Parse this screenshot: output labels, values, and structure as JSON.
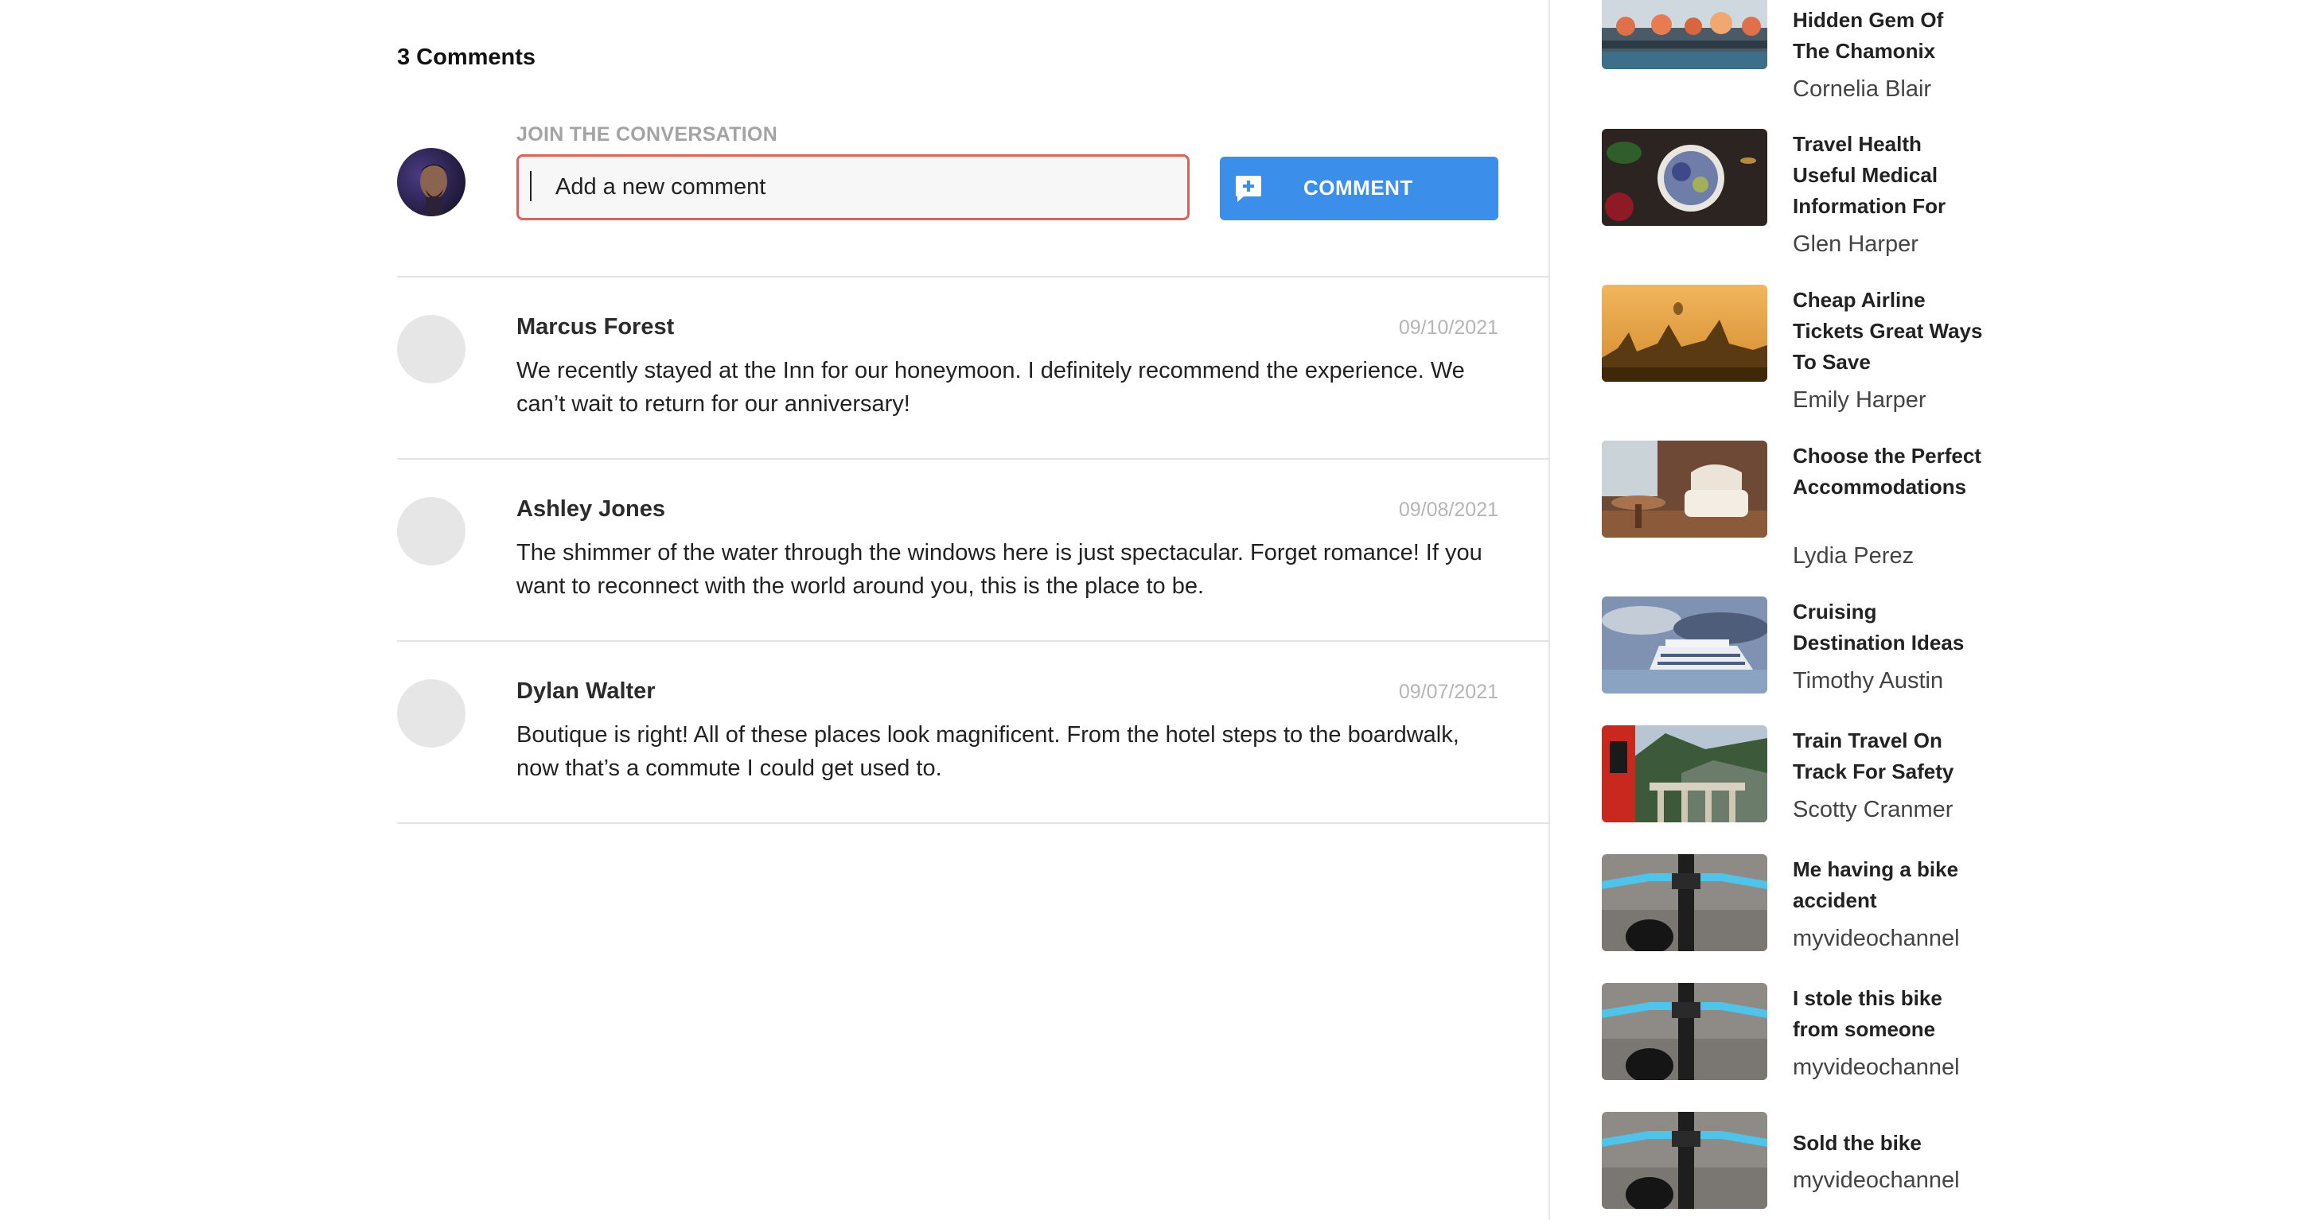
{
  "comments_section": {
    "count_label": "3 Comments",
    "join_label": "JOIN THE CONVERSATION",
    "input_placeholder": "Add a new comment",
    "button_label": "COMMENT",
    "comments": [
      {
        "author": "Marcus Forest",
        "date": "09/10/2021",
        "text": "We recently stayed at the Inn for our honeymoon. I definitely recommend the experience. We can’t wait to return for our anniversary!"
      },
      {
        "author": "Ashley Jones",
        "date": "09/08/2021",
        "text": "The shimmer of the water through the windows here is just spectacular. Forget romance! If you want to reconnect with the world around you, this is the place to be."
      },
      {
        "author": "Dylan Walter",
        "date": "09/07/2021",
        "text": "Boutique is right! All of these places look magnificent. From the hotel steps to the boardwalk, now that’s a commute I could get used to."
      }
    ]
  },
  "sidebar": {
    "items": [
      {
        "title": "Hidden Gem Of The Chamonix",
        "author": "Cornelia Blair",
        "thumb": "pumpkins"
      },
      {
        "title": "Travel Health Useful Medical Information For",
        "author": "Glen Harper",
        "thumb": "food-bowl"
      },
      {
        "title": "Cheap Airline Tickets Great Ways To Save",
        "author": "Emily Harper",
        "thumb": "balloons"
      },
      {
        "title": "Choose the Perfect Accommodations",
        "author": "Lydia Perez",
        "thumb": "armchair"
      },
      {
        "title": "Cruising Destination Ideas",
        "author": "Timothy Austin",
        "thumb": "cruise-ship"
      },
      {
        "title": "Train Travel On Track For Safety",
        "author": "Scotty Cranmer",
        "thumb": "train"
      },
      {
        "title": "Me having a bike accident",
        "author": "myvideochannel",
        "thumb": "bike"
      },
      {
        "title": "I stole this bike from someone",
        "author": "myvideochannel",
        "thumb": "bike"
      },
      {
        "title": "Sold the bike",
        "author": "myvideochannel",
        "thumb": "bike"
      }
    ]
  },
  "colors": {
    "accent_button": "#3b8eea",
    "input_border": "#d9625e",
    "muted_label": "#a3a3a3"
  }
}
